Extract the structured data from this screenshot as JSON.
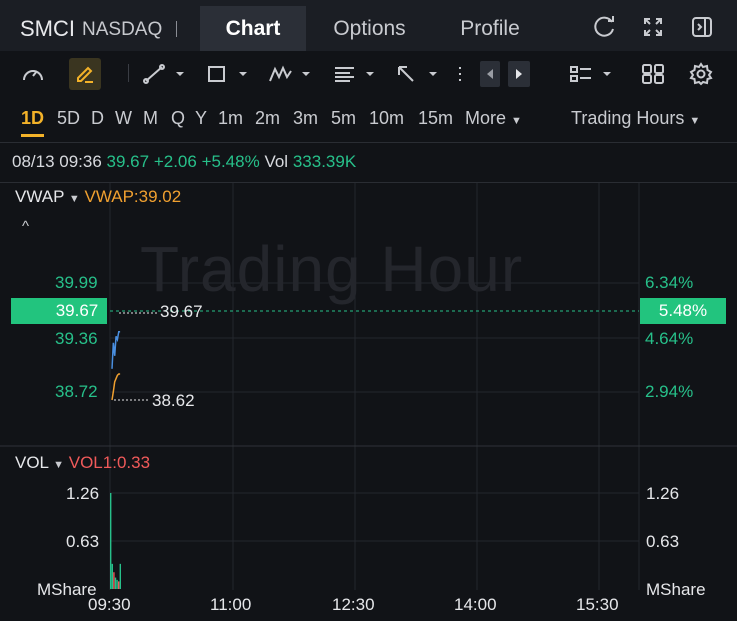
{
  "header": {
    "ticker": "SMCI",
    "exchange": "NASDAQ",
    "tabs": [
      {
        "label": "Chart",
        "active": true
      },
      {
        "label": "Options",
        "active": false
      },
      {
        "label": "Profile",
        "active": false
      }
    ],
    "icons": [
      "refresh-icon",
      "fullscreen-icon",
      "collapse-panel-icon"
    ]
  },
  "toolbar": {
    "icons": [
      "indicator-gauge-icon",
      "draw-pen-icon",
      "trend-line-icon",
      "rectangle-tool-icon",
      "pattern-tool-icon",
      "text-tool-icon",
      "arrow-tool-icon",
      "more-tools-icon",
      "scroll-left-icon",
      "scroll-right-icon",
      "layout-list-icon",
      "grid-layout-icon",
      "settings-icon"
    ]
  },
  "timeframes": {
    "items": [
      "1D",
      "5D",
      "D",
      "W",
      "M",
      "Q",
      "Y",
      "1m",
      "2m",
      "3m",
      "5m",
      "10m",
      "15m",
      "More"
    ],
    "active": "1D",
    "session": "Trading Hours"
  },
  "quote": {
    "datetime": "08/13 09:36",
    "price": "39.67",
    "change": "+2.06",
    "change_pct": "+5.48%",
    "vol_label": "Vol",
    "volume": "333.39K"
  },
  "price_panel": {
    "indicator": "VWAP",
    "indicator_value": "VWAP:39.02",
    "watermark": "Trading Hour",
    "left_axis": [
      "39.99",
      "39.67",
      "39.36",
      "38.72"
    ],
    "right_axis": [
      "6.34%",
      "5.48%",
      "4.64%",
      "2.94%"
    ],
    "high_label": "39.67",
    "low_label": "38.62"
  },
  "volume_panel": {
    "indicator": "VOL",
    "indicator_value": "VOL1:0.33",
    "left_axis": [
      "1.26",
      "0.63",
      "MShare"
    ],
    "right_axis": [
      "1.26",
      "0.63",
      "MShare"
    ]
  },
  "time_axis": [
    "09:30",
    "11:00",
    "12:30",
    "14:00",
    "15:30"
  ],
  "chart_data": {
    "type": "line",
    "x": [
      "09:30",
      "09:31",
      "09:32",
      "09:33",
      "09:34",
      "09:35",
      "09:36"
    ],
    "series": [
      {
        "name": "",
        "values": [
          39.1,
          39.5,
          39.3,
          39.6,
          39.55,
          39.67,
          39.67
        ]
      },
      {
        "name": "VWAP",
        "values": [
          38.62,
          38.75,
          38.9,
          38.95,
          39.0,
          39.02,
          39.02
        ]
      }
    ],
    "volume": {
      "name": "VOL",
      "values": [
        1.26,
        0.33,
        0.22,
        0.15,
        0.12,
        0.1,
        0.33
      ]
    },
    "ylim": [
      38.62,
      39.99
    ],
    "grid": true,
    "colors": {
      "up": "#27c08a",
      "price_line": "#4a8fe0",
      "vwap": "#f0a030",
      "vol_down": "#f05a5a"
    }
  }
}
